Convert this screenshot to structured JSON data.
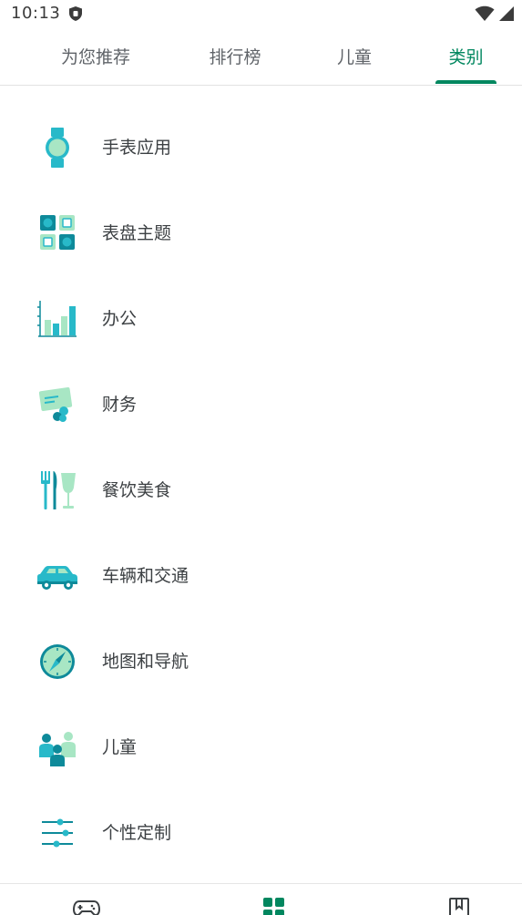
{
  "status_bar": {
    "time": "10:13",
    "icons": [
      "shield-icon",
      "wifi-icon",
      "signal-icon"
    ]
  },
  "tabs": [
    {
      "label": "为您推荐",
      "active": false
    },
    {
      "label": "排行榜",
      "active": false
    },
    {
      "label": "儿童",
      "active": false
    },
    {
      "label": "类别",
      "active": true
    }
  ],
  "categories": [
    {
      "label": "手表应用",
      "icon": "watch-icon"
    },
    {
      "label": "表盘主题",
      "icon": "watch-face-grid-icon"
    },
    {
      "label": "办公",
      "icon": "office-chart-icon"
    },
    {
      "label": "财务",
      "icon": "finance-card-icon"
    },
    {
      "label": "餐饮美食",
      "icon": "food-drink-icon"
    },
    {
      "label": "车辆和交通",
      "icon": "car-icon"
    },
    {
      "label": "地图和导航",
      "icon": "compass-icon"
    },
    {
      "label": "儿童",
      "icon": "kids-icon"
    },
    {
      "label": "个性定制",
      "icon": "sliders-icon"
    }
  ],
  "bottom_nav": {
    "items": [
      "games-icon",
      "apps-icon",
      "books-icon"
    ]
  },
  "colors": {
    "accent": "#01875f",
    "icon_teal": "#28b9c9",
    "icon_dark_teal": "#0e8a9a",
    "icon_mint": "#a8e6c4",
    "text_primary": "#3c4043",
    "text_secondary": "#5f6368"
  }
}
